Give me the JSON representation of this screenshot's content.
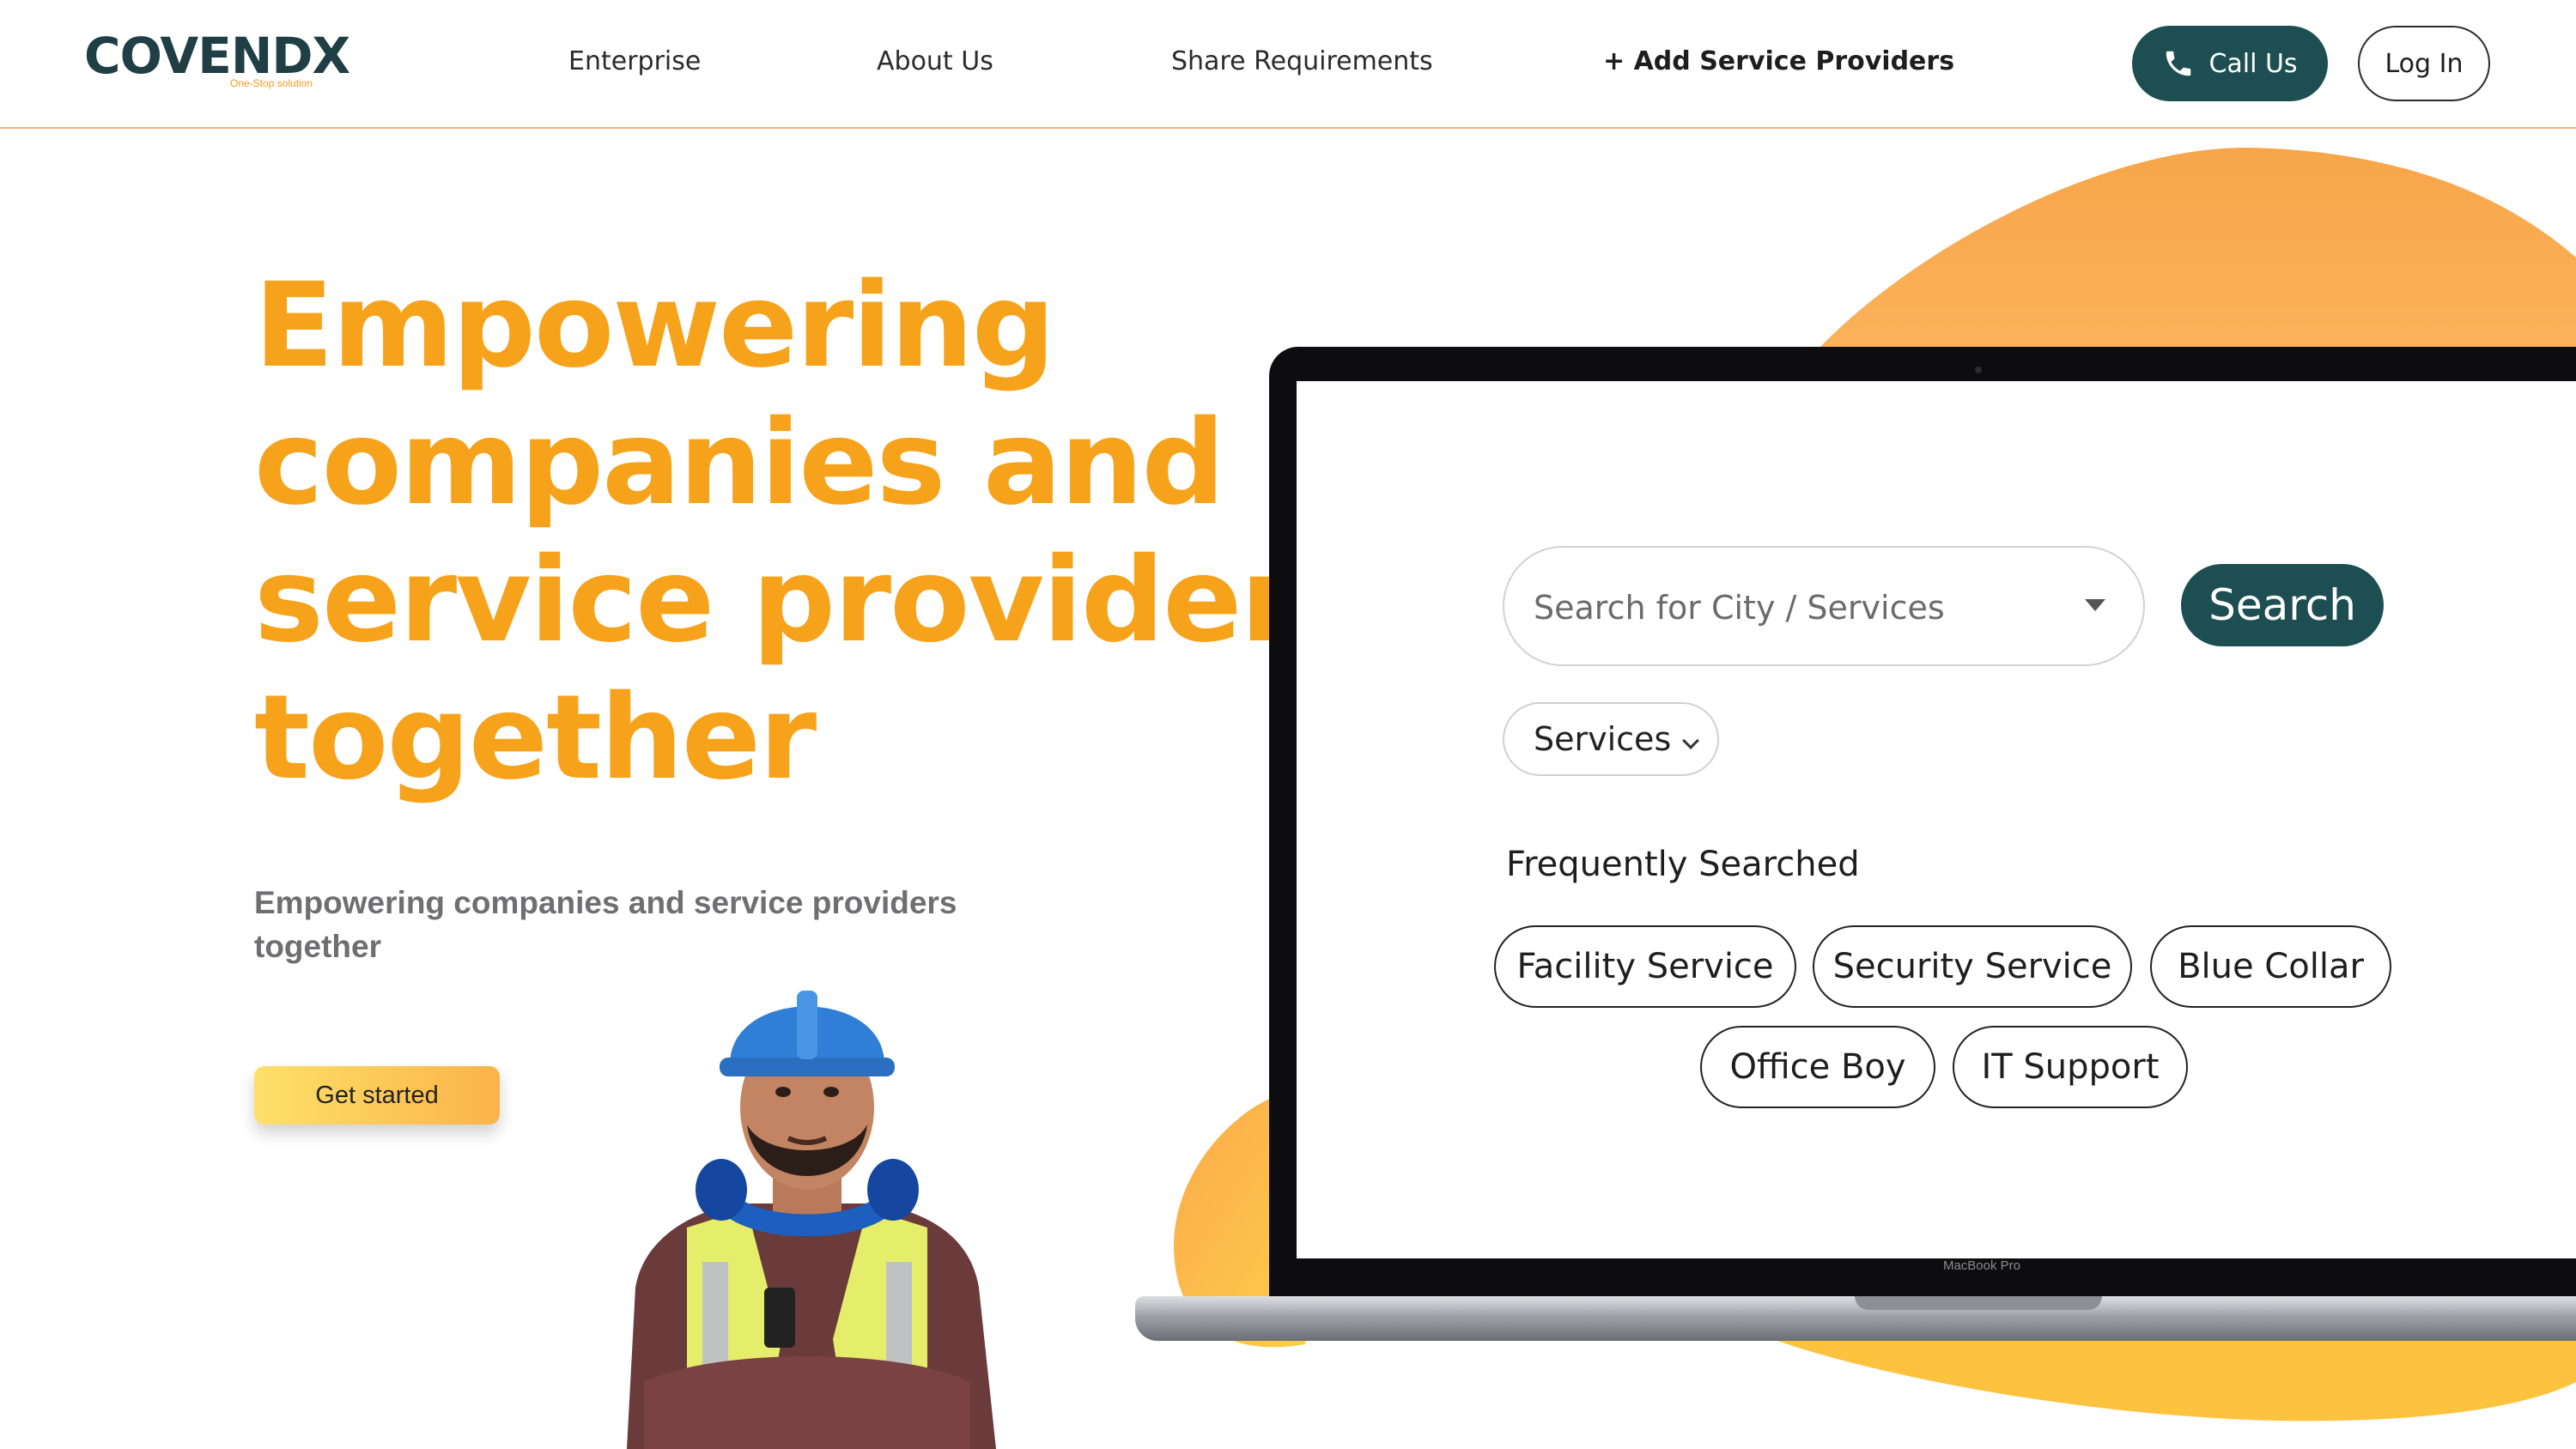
{
  "brand": {
    "logo_text": "COVENDX",
    "tagline": "One-Stop solution",
    "primary_color": "#1d4e52",
    "accent_color": "#f7a21b"
  },
  "nav": {
    "items": [
      {
        "label": "Enterprise"
      },
      {
        "label": "About Us"
      },
      {
        "label": "Share Requirements"
      },
      {
        "label": "+ Add Service Providers"
      }
    ],
    "call_label": "Call Us",
    "call_icon": "phone-icon",
    "login_label": "Log In"
  },
  "hero": {
    "title_lines": [
      "Empowering",
      "companies and",
      "service providers",
      "together"
    ],
    "subtitle": "Empowering companies and service providers together",
    "cta_label": "Get started"
  },
  "laptop": {
    "model_label": "MacBook Pro",
    "search": {
      "placeholder": "Search for City / Services",
      "button_label": "Search"
    },
    "category_select": {
      "selected": "Services"
    },
    "frequently_searched": {
      "title": "Frequently Searched",
      "chips": [
        {
          "label": "Facility Service"
        },
        {
          "label": "Security Service"
        },
        {
          "label": "Blue Collar"
        },
        {
          "label": "Office Boy"
        },
        {
          "label": "IT Support"
        }
      ]
    }
  }
}
